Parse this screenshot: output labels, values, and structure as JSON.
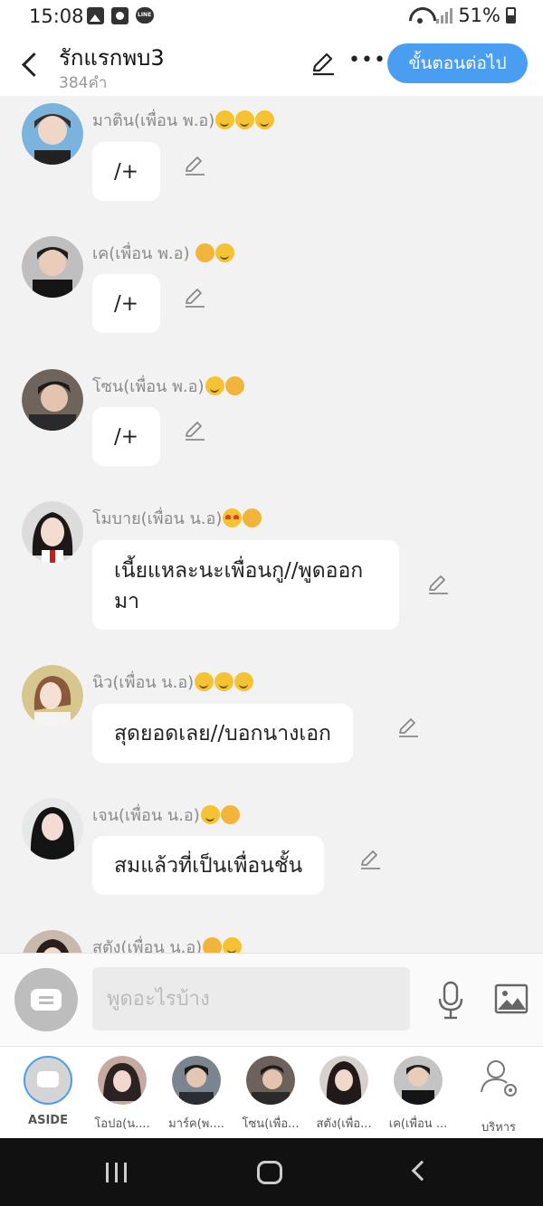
{
  "status_bar": {
    "time": "15:08",
    "battery": "51%"
  },
  "header": {
    "title": "รักแรกพบ3",
    "word_count": "384คำ",
    "next_button": "ขั้นตอนต่อไป"
  },
  "messages": [
    {
      "sender": "มาติน(เพื่อน พ.อ)",
      "emojis": [
        "smirk-emoji",
        "smile-emoji",
        "grin-emoji"
      ],
      "text": "/+",
      "avatar_color": "#7ab3dd"
    },
    {
      "sender": "เค(เพื่อน พ.อ) ",
      "emojis": [
        "kiss-wink-emoji",
        "smile-emoji"
      ],
      "text": "/+",
      "avatar_color": "#5a5a5a"
    },
    {
      "sender": "โซน(เพื่อน พ.อ)",
      "emojis": [
        "grin-emoji",
        "kiss-emoji"
      ],
      "text": "/+",
      "avatar_color": "#3d3835"
    },
    {
      "sender": "โมบาย(เพื่อน น.อ)",
      "emojis": [
        "heart-eyes-emoji",
        "kiss-emoji"
      ],
      "text": "เนี้ยแหละนะเพื่อนกู//พูดออกมา",
      "avatar_color": "#2e2a2a"
    },
    {
      "sender": "นิว(เพื่อน น.อ)",
      "emojis": [
        "smirk-emoji",
        "smile-emoji",
        "grin-emoji"
      ],
      "text": "สุดยอดเลย//บอกนางเอก",
      "avatar_color": "#d9c48f"
    },
    {
      "sender": "เจน(เพื่อน น.อ)",
      "emojis": [
        "grin-emoji",
        "kiss-emoji"
      ],
      "text": "สมแล้วที่เป็นเพื่อนชั้น",
      "avatar_color": "#1f1f1f"
    },
    {
      "sender": "สตัง(เพื่อน น.อ)",
      "emojis": [
        "kiss-wink-emoji",
        "smile-emoji"
      ],
      "text": "",
      "avatar_color": "#3a2a26"
    }
  ],
  "input": {
    "placeholder": "พูดอะไรบ้าง"
  },
  "characters": [
    {
      "label": "ASIDE",
      "type": "aside"
    },
    {
      "label": "โอปอ(น....",
      "avatar_color": "#3a3030"
    },
    {
      "label": "มาร์ค(พ....",
      "avatar_color": "#4a5058"
    },
    {
      "label": "โซน(เพื่อ...",
      "avatar_color": "#2f2a27"
    },
    {
      "label": "สตัง(เพื่อ...",
      "avatar_color": "#2c2424"
    },
    {
      "label": "เค(เพื่อน ...",
      "avatar_color": "#575757"
    },
    {
      "label": "บริหาร",
      "type": "manage"
    }
  ],
  "colors": {
    "accent": "#4a9ef2",
    "bubble": "#ffffff",
    "background": "#f2f2f2"
  }
}
